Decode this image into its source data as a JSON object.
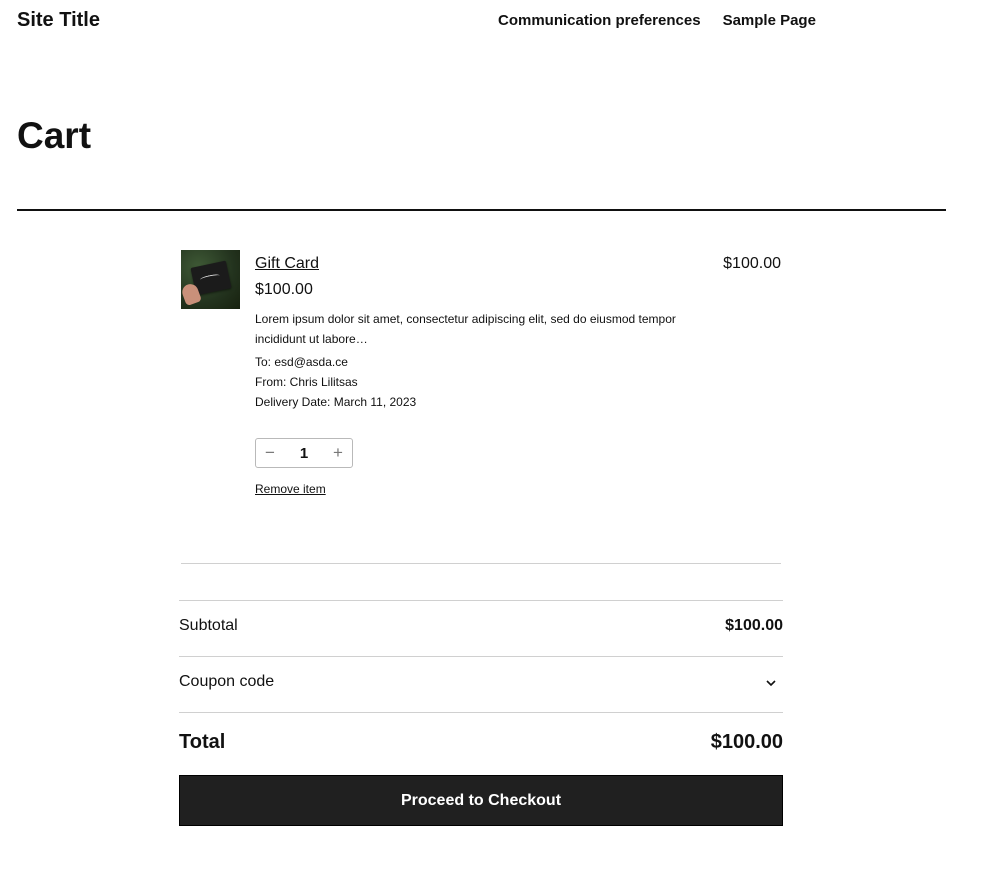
{
  "header": {
    "site_title": "Site Title",
    "nav": [
      "Communication preferences",
      "Sample Page"
    ]
  },
  "page": {
    "title": "Cart"
  },
  "cart": {
    "item": {
      "name": "Gift Card",
      "price": "$100.00",
      "description": "Lorem ipsum dolor sit amet, consectetur adipiscing elit, sed do eiusmod tempor incididunt ut labore…",
      "to": "To: esd@asda.ce",
      "from": "From: Chris Lilitsas",
      "delivery": "Delivery Date: March 11, 2023",
      "quantity": "1",
      "decrement": "−",
      "increment": "+",
      "remove_label": "Remove item",
      "line_total": "$100.00",
      "image_icon": "gift-card-thumbnail"
    },
    "totals": {
      "subtotal_label": "Subtotal",
      "subtotal_value": "$100.00",
      "coupon_label": "Coupon code",
      "total_label": "Total",
      "total_value": "$100.00"
    },
    "checkout_label": "Proceed to Checkout"
  },
  "colors": {
    "text": "#111111",
    "button_bg": "#202020",
    "divider": "#d0d0d0"
  }
}
